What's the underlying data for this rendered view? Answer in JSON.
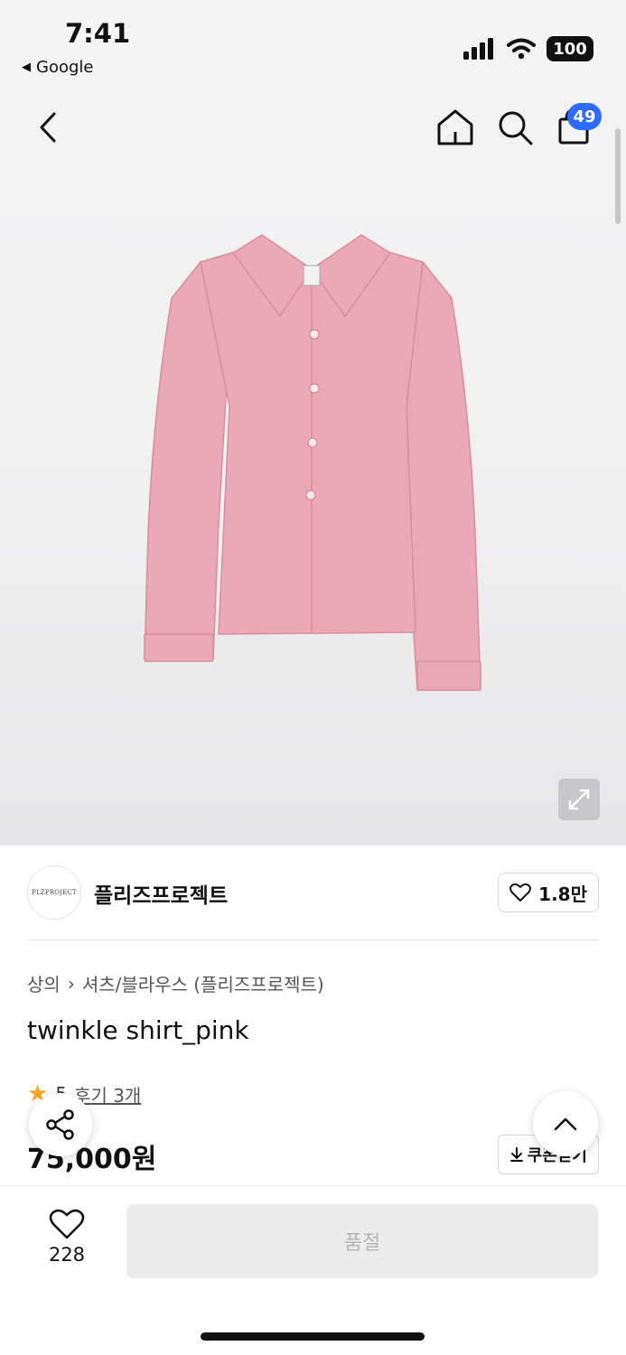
{
  "status_bar": {
    "time": "7:41",
    "back_app": "Google",
    "battery": "100"
  },
  "header": {
    "cart_count": "49"
  },
  "brand": {
    "logo_text": "PLZPROJECT",
    "name": "플리즈프로젝트",
    "likes": "1.8만"
  },
  "product": {
    "category": "상의",
    "subcategory": "셔츠/블라우스 (플리즈프로젝트)",
    "title": "twinkle shirt_pink",
    "rating": "5",
    "reviews": "후기 3개",
    "price": "75,000원",
    "coupon_label": "쿠폰받기"
  },
  "bottom_bar": {
    "wish_count": "228",
    "soldout_label": "품절"
  },
  "colors": {
    "badge": "#2f6bff",
    "star": "#f5a623",
    "shirt": "#eaa9b4"
  },
  "icons": [
    "back-chevron-icon",
    "home-icon",
    "search-icon",
    "shopping-bag-icon",
    "expand-icon",
    "heart-icon",
    "share-icon",
    "chevron-up-icon",
    "download-icon",
    "star-icon"
  ]
}
